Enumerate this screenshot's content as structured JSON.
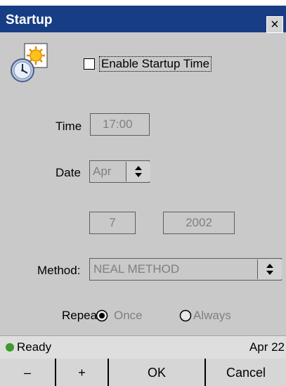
{
  "window": {
    "title": "Startup",
    "close_glyph": "×"
  },
  "enable_startup_time": {
    "label": "Enable Startup Time",
    "checked": false
  },
  "time": {
    "label": "Time",
    "value": "17:00"
  },
  "date": {
    "label": "Date",
    "month": "Apr",
    "day": "7",
    "year": "2002"
  },
  "method": {
    "label": "Method:",
    "value": "NEAL METHOD"
  },
  "repeat": {
    "label": "Repeat",
    "options": [
      "Once",
      "Always"
    ],
    "selected": "Once"
  },
  "status": {
    "text": "Ready",
    "date": "Apr 22"
  },
  "buttons": {
    "minus": "–",
    "plus": "+",
    "ok": "OK",
    "cancel": "Cancel"
  },
  "icons": {
    "app": "clock-sun-icon",
    "close": "close-icon",
    "spinner": "up-down-arrows-icon",
    "status": "status-led-icon"
  },
  "colors": {
    "titlebar": "#173d85",
    "window_bg": "#c9c9c9",
    "status_led": "#3d9a2d",
    "disabled_text": "#808080"
  }
}
